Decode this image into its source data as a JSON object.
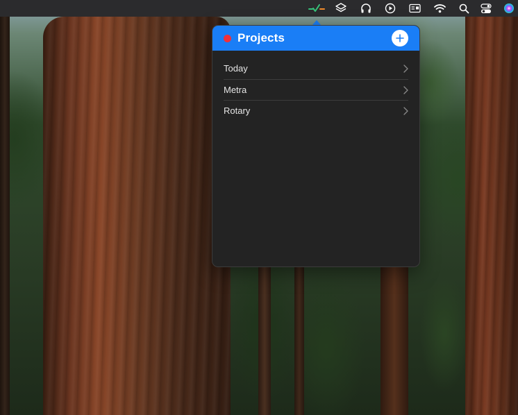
{
  "menubar": {
    "icons": [
      "app-checkmark-icon",
      "layers-icon",
      "headphones-icon",
      "play-circle-icon",
      "display-icon",
      "wifi-icon",
      "search-icon",
      "control-center-icon",
      "siri-icon"
    ]
  },
  "popover": {
    "title": "Projects",
    "status_color": "#f2303a",
    "header_color": "#1a7ef6",
    "projects": [
      {
        "label": "Today"
      },
      {
        "label": "Metra"
      },
      {
        "label": "Rotary"
      }
    ]
  }
}
